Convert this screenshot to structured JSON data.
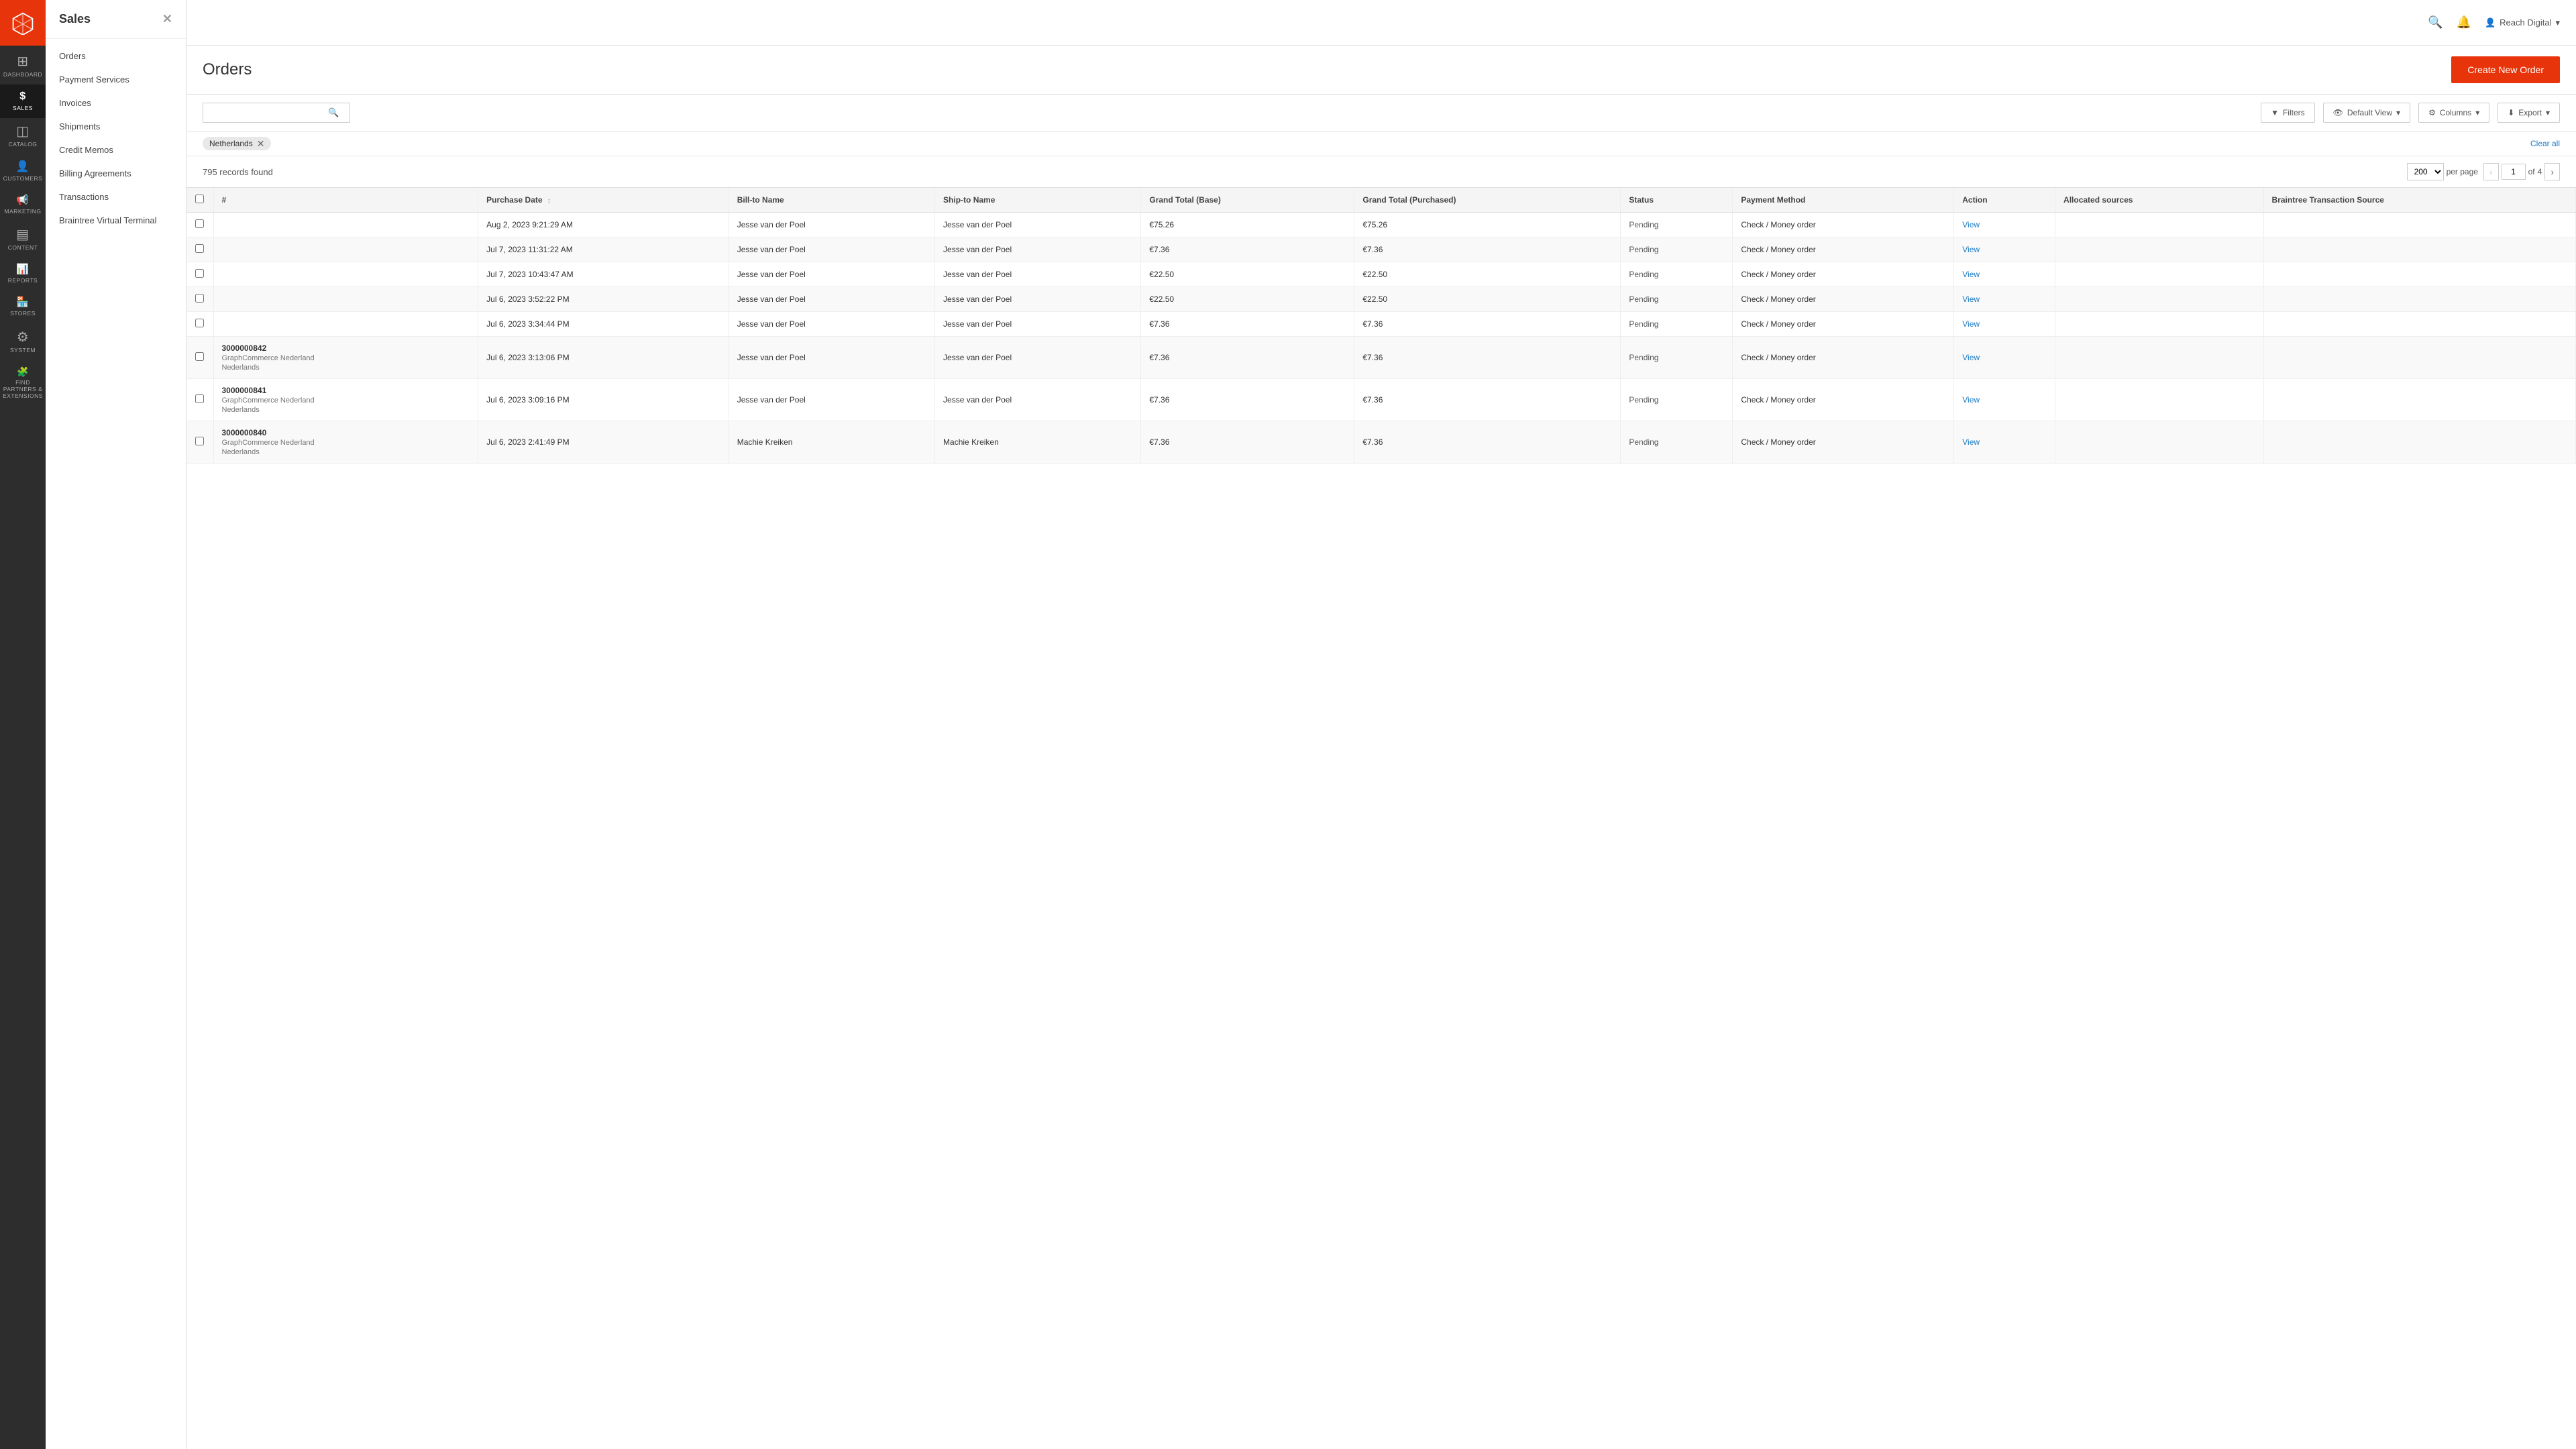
{
  "app": {
    "logo_alt": "Magento"
  },
  "icon_sidebar": {
    "items": [
      {
        "id": "dashboard",
        "label": "Dashboard",
        "icon": "⊞",
        "active": false
      },
      {
        "id": "sales",
        "label": "Sales",
        "icon": "$",
        "active": true
      },
      {
        "id": "catalog",
        "label": "Catalog",
        "icon": "◫",
        "active": false
      },
      {
        "id": "customers",
        "label": "Customers",
        "icon": "👤",
        "active": false
      },
      {
        "id": "marketing",
        "label": "Marketing",
        "icon": "📢",
        "active": false
      },
      {
        "id": "content",
        "label": "Content",
        "icon": "▤",
        "active": false
      },
      {
        "id": "reports",
        "label": "Reports",
        "icon": "📊",
        "active": false
      },
      {
        "id": "stores",
        "label": "Stores",
        "icon": "🏪",
        "active": false
      },
      {
        "id": "system",
        "label": "System",
        "icon": "⚙",
        "active": false
      },
      {
        "id": "find-partners",
        "label": "Find Partners & Extensions",
        "icon": "🧩",
        "active": false
      }
    ]
  },
  "flyout": {
    "title": "Sales",
    "nav_items": [
      {
        "id": "orders",
        "label": "Orders"
      },
      {
        "id": "payment-services",
        "label": "Payment Services"
      },
      {
        "id": "invoices",
        "label": "Invoices"
      },
      {
        "id": "shipments",
        "label": "Shipments"
      },
      {
        "id": "credit-memos",
        "label": "Credit Memos"
      },
      {
        "id": "billing-agreements",
        "label": "Billing Agreements"
      },
      {
        "id": "transactions",
        "label": "Transactions"
      },
      {
        "id": "braintree-terminal",
        "label": "Braintree Virtual Terminal"
      }
    ]
  },
  "topbar": {
    "user_name": "Reach Digital",
    "search_placeholder": "Search..."
  },
  "page": {
    "title": "Orders",
    "create_button_label": "Create New Order"
  },
  "toolbar": {
    "search_placeholder": "",
    "filters_label": "Filters",
    "default_view_label": "Default View",
    "columns_label": "Columns",
    "export_label": "Export"
  },
  "filter_row": {
    "tag_label": "Netherlands",
    "clear_all_label": "Clear all"
  },
  "records_bar": {
    "records_text": "795 records found",
    "per_page_value": "200",
    "per_page_label": "per page",
    "page_current": "1",
    "page_total": "4",
    "page_of_label": "of"
  },
  "table": {
    "columns": [
      {
        "id": "checkbox",
        "label": ""
      },
      {
        "id": "order-num",
        "label": "#"
      },
      {
        "id": "purchase-date",
        "label": "Purchase Date",
        "sortable": true
      },
      {
        "id": "bill-to-name",
        "label": "Bill-to Name"
      },
      {
        "id": "ship-to-name",
        "label": "Ship-to Name"
      },
      {
        "id": "grand-total-base",
        "label": "Grand Total (Base)"
      },
      {
        "id": "grand-total-purchased",
        "label": "Grand Total (Purchased)"
      },
      {
        "id": "status",
        "label": "Status"
      },
      {
        "id": "payment-method",
        "label": "Payment Method"
      },
      {
        "id": "action",
        "label": "Action"
      },
      {
        "id": "allocated-sources",
        "label": "Allocated sources"
      },
      {
        "id": "braintree-source",
        "label": "Braintree Transaction Source"
      }
    ],
    "rows": [
      {
        "checkbox": false,
        "order_num": "",
        "purchase_date": "Aug 2, 2023 9:21:29 AM",
        "bill_to_name": "Jesse van der Poel",
        "ship_to_name": "Jesse van der Poel",
        "grand_total_base": "€75.26",
        "grand_total_purchased": "€75.26",
        "status": "Pending",
        "payment_method": "Check / Money order",
        "action": "View"
      },
      {
        "checkbox": false,
        "order_num": "",
        "purchase_date": "Jul 7, 2023 11:31:22 AM",
        "bill_to_name": "Jesse van der Poel",
        "ship_to_name": "Jesse van der Poel",
        "grand_total_base": "€7.36",
        "grand_total_purchased": "€7.36",
        "status": "Pending",
        "payment_method": "Check / Money order",
        "action": "View"
      },
      {
        "checkbox": false,
        "order_num": "",
        "purchase_date": "Jul 7, 2023 10:43:47 AM",
        "bill_to_name": "Jesse van der Poel",
        "ship_to_name": "Jesse van der Poel",
        "grand_total_base": "€22.50",
        "grand_total_purchased": "€22.50",
        "status": "Pending",
        "payment_method": "Check / Money order",
        "action": "View"
      },
      {
        "checkbox": false,
        "order_num": "",
        "purchase_date": "Jul 6, 2023 3:52:22 PM",
        "bill_to_name": "Jesse van der Poel",
        "ship_to_name": "Jesse van der Poel",
        "grand_total_base": "€22.50",
        "grand_total_purchased": "€22.50",
        "status": "Pending",
        "payment_method": "Check / Money order",
        "action": "View"
      },
      {
        "checkbox": false,
        "order_num": "",
        "purchase_date": "Jul 6, 2023 3:34:44 PM",
        "bill_to_name": "Jesse van der Poel",
        "ship_to_name": "Jesse van der Poel",
        "grand_total_base": "€7.36",
        "grand_total_purchased": "€7.36",
        "status": "Pending",
        "payment_method": "Check / Money order",
        "action": "View"
      },
      {
        "checkbox": false,
        "order_num": "3000000842",
        "store": "GraphCommerce Nederland",
        "locale": "Nederlands",
        "purchase_date": "Jul 6, 2023 3:13:06 PM",
        "bill_to_name": "Jesse van der Poel",
        "ship_to_name": "Jesse van der Poel",
        "grand_total_base": "€7.36",
        "grand_total_purchased": "€7.36",
        "status": "Pending",
        "payment_method": "Check / Money order",
        "action": "View"
      },
      {
        "checkbox": false,
        "order_num": "3000000841",
        "store": "GraphCommerce Nederland",
        "locale": "Nederlands",
        "purchase_date": "Jul 6, 2023 3:09:16 PM",
        "bill_to_name": "Jesse van der Poel",
        "ship_to_name": "Jesse van der Poel",
        "grand_total_base": "€7.36",
        "grand_total_purchased": "€7.36",
        "status": "Pending",
        "payment_method": "Check / Money order",
        "action": "View"
      },
      {
        "checkbox": false,
        "order_num": "3000000840",
        "store": "GraphCommerce Nederland",
        "locale": "Nederlands",
        "purchase_date": "Jul 6, 2023 2:41:49 PM",
        "bill_to_name": "Machie Kreiken",
        "ship_to_name": "Machie Kreiken",
        "grand_total_base": "€7.36",
        "grand_total_purchased": "€7.36",
        "status": "Pending",
        "payment_method": "Check / Money order",
        "action": "View"
      }
    ]
  }
}
